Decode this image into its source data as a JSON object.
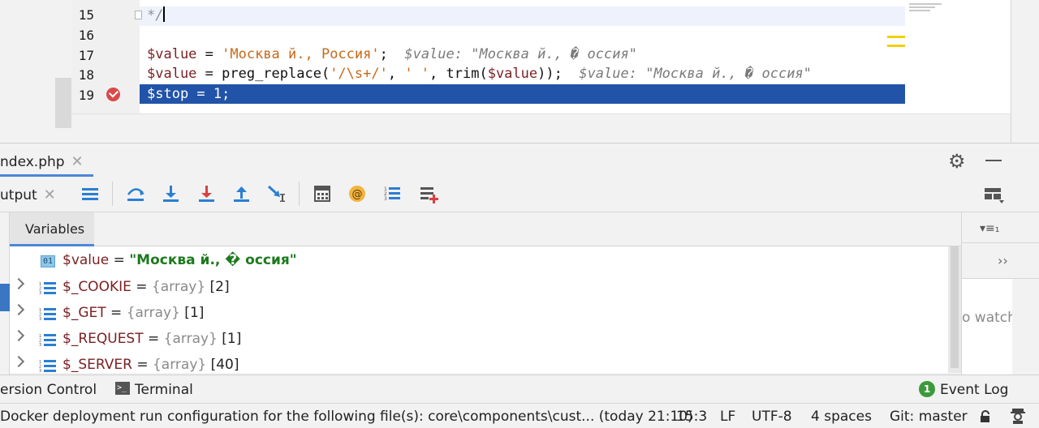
{
  "editor": {
    "lines": [
      {
        "num": "15",
        "comment": "*/"
      },
      {
        "num": "16"
      },
      {
        "num": "17",
        "var": "$value",
        "op": " = ",
        "str": "'Москва й., Россия'",
        "end": ";",
        "inline": "$value: \"Москва й., � оссия\""
      },
      {
        "num": "18",
        "var": "$value",
        "op": " = preg_replace(",
        "s1": "'/\\s+/'",
        "c1": ", ",
        "s2": "' '",
        "mid": ", trim(",
        "var2": "$value",
        "end": "));",
        "inline": "$value: \"Москва й., � оссия\""
      },
      {
        "num": "19",
        "code": "$stop = 1;"
      }
    ]
  },
  "debug": {
    "tab_label": "ndex.php",
    "output_label": "utput",
    "variables_tab": "Variables",
    "variables": [
      {
        "name": "$value",
        "op": " = ",
        "value": "\"Москва й., � оссия\"",
        "kind": "string",
        "icon_text": "01"
      },
      {
        "name": "$_COOKIE",
        "op": " = ",
        "type": "{array}",
        "count": " [2]",
        "kind": "array"
      },
      {
        "name": "$_GET",
        "op": " = ",
        "type": "{array}",
        "count": " [1]",
        "kind": "array"
      },
      {
        "name": "$_REQUEST",
        "op": " = ",
        "type": "{array}",
        "count": " [1]",
        "kind": "array"
      },
      {
        "name": "$_SERVER",
        "op": " = ",
        "type": "{array}",
        "count": " [40]",
        "kind": "array"
      }
    ],
    "watches_hint": "o watch",
    "watches_menu": "▾≡₁",
    "watches_more": "››"
  },
  "tool_tabs": {
    "vcs": "ersion Control",
    "terminal": "Terminal",
    "terminal_icon": ">_",
    "event_log": "Event Log",
    "event_log_badge": "1"
  },
  "status": {
    "message": "Docker deployment run configuration for the following file(s): core\\components\\cust... (today 21:10)",
    "position": "15:3",
    "line_sep": "LF",
    "encoding": "UTF-8",
    "indent": "4 spaces",
    "vcs": "Git: master"
  },
  "icons": {
    "gear": "gear-icon",
    "close": "close-icon",
    "breakpoint": "breakpoint-check-icon",
    "lock": "lock-icon",
    "inspector": "hector-inspector-icon"
  },
  "colors": {
    "exec_line": "#2154a8",
    "accent": "#4a88d8",
    "variable": "#7b1f22",
    "string": "#c7691a",
    "string_value": "#1e7a1e",
    "toolbar_blue": "#2a7fd4",
    "toolbar_red": "#d94040"
  }
}
